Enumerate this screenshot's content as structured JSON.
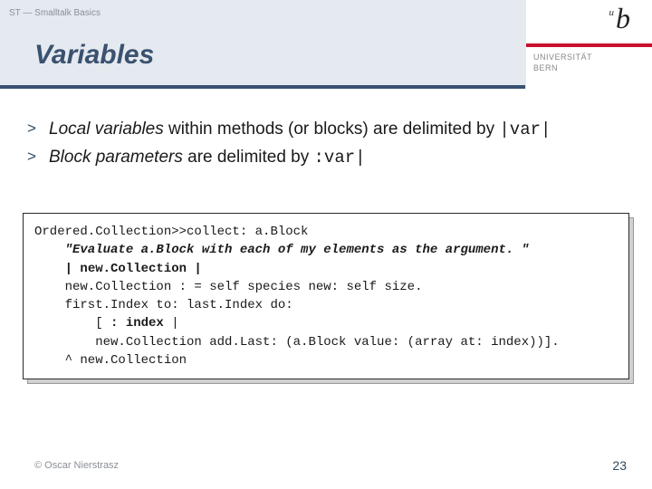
{
  "breadcrumb": "ST — Smalltalk Basics",
  "title": "Variables",
  "logo": {
    "u": "u",
    "b": "b",
    "uni_line1": "UNIVERSITÄT",
    "uni_line2": "BERN"
  },
  "bullets": [
    {
      "marker": ">",
      "em": "Local variables",
      "plain1": " within methods (or blocks) are delimited by ",
      "code": "|var|"
    },
    {
      "marker": ">",
      "em": "Block parameters",
      "plain1": " are delimited by ",
      "code": ":var|"
    }
  ],
  "code": {
    "l1": "Ordered.Collection>>collect: a.Block",
    "l2": "    \"Evaluate a.Block with each of my elements as the argument. \"",
    "l3a": "    ",
    "l3b": "| new.Collection |",
    "l4": "    new.Collection : = self species new: self size.",
    "l5": "    first.Index to: last.Index do:",
    "l6a": "        [ ",
    "l6b": ": index",
    "l6c": " |",
    "l7": "        new.Collection add.Last: (a.Block value: (array at: index))].",
    "l8": "    ^ new.Collection"
  },
  "footer": {
    "copyright": "© Oscar Nierstrasz",
    "page": "23"
  }
}
